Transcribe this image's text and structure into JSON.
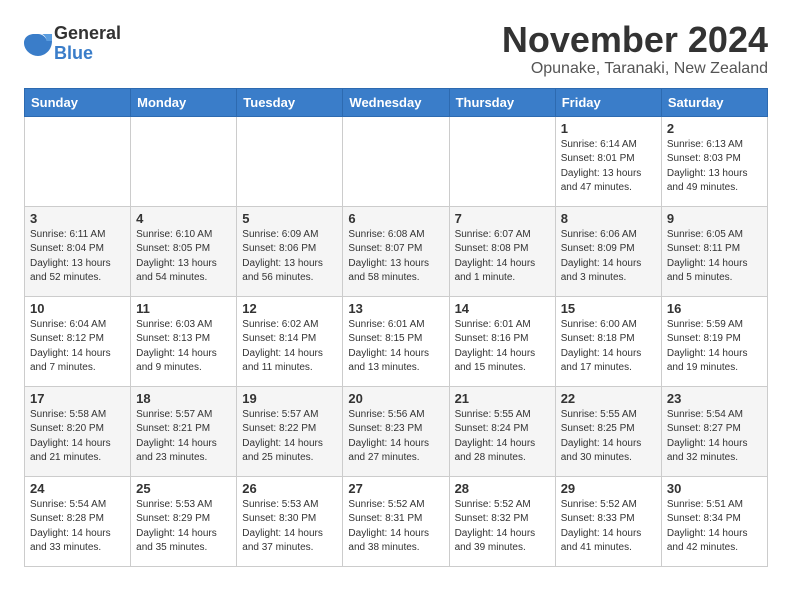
{
  "logo": {
    "general": "General",
    "blue": "Blue"
  },
  "title": "November 2024",
  "location": "Opunake, Taranaki, New Zealand",
  "weekdays": [
    "Sunday",
    "Monday",
    "Tuesday",
    "Wednesday",
    "Thursday",
    "Friday",
    "Saturday"
  ],
  "weeks": [
    [
      {
        "day": "",
        "info": ""
      },
      {
        "day": "",
        "info": ""
      },
      {
        "day": "",
        "info": ""
      },
      {
        "day": "",
        "info": ""
      },
      {
        "day": "",
        "info": ""
      },
      {
        "day": "1",
        "info": "Sunrise: 6:14 AM\nSunset: 8:01 PM\nDaylight: 13 hours\nand 47 minutes."
      },
      {
        "day": "2",
        "info": "Sunrise: 6:13 AM\nSunset: 8:03 PM\nDaylight: 13 hours\nand 49 minutes."
      }
    ],
    [
      {
        "day": "3",
        "info": "Sunrise: 6:11 AM\nSunset: 8:04 PM\nDaylight: 13 hours\nand 52 minutes."
      },
      {
        "day": "4",
        "info": "Sunrise: 6:10 AM\nSunset: 8:05 PM\nDaylight: 13 hours\nand 54 minutes."
      },
      {
        "day": "5",
        "info": "Sunrise: 6:09 AM\nSunset: 8:06 PM\nDaylight: 13 hours\nand 56 minutes."
      },
      {
        "day": "6",
        "info": "Sunrise: 6:08 AM\nSunset: 8:07 PM\nDaylight: 13 hours\nand 58 minutes."
      },
      {
        "day": "7",
        "info": "Sunrise: 6:07 AM\nSunset: 8:08 PM\nDaylight: 14 hours\nand 1 minute."
      },
      {
        "day": "8",
        "info": "Sunrise: 6:06 AM\nSunset: 8:09 PM\nDaylight: 14 hours\nand 3 minutes."
      },
      {
        "day": "9",
        "info": "Sunrise: 6:05 AM\nSunset: 8:11 PM\nDaylight: 14 hours\nand 5 minutes."
      }
    ],
    [
      {
        "day": "10",
        "info": "Sunrise: 6:04 AM\nSunset: 8:12 PM\nDaylight: 14 hours\nand 7 minutes."
      },
      {
        "day": "11",
        "info": "Sunrise: 6:03 AM\nSunset: 8:13 PM\nDaylight: 14 hours\nand 9 minutes."
      },
      {
        "day": "12",
        "info": "Sunrise: 6:02 AM\nSunset: 8:14 PM\nDaylight: 14 hours\nand 11 minutes."
      },
      {
        "day": "13",
        "info": "Sunrise: 6:01 AM\nSunset: 8:15 PM\nDaylight: 14 hours\nand 13 minutes."
      },
      {
        "day": "14",
        "info": "Sunrise: 6:01 AM\nSunset: 8:16 PM\nDaylight: 14 hours\nand 15 minutes."
      },
      {
        "day": "15",
        "info": "Sunrise: 6:00 AM\nSunset: 8:18 PM\nDaylight: 14 hours\nand 17 minutes."
      },
      {
        "day": "16",
        "info": "Sunrise: 5:59 AM\nSunset: 8:19 PM\nDaylight: 14 hours\nand 19 minutes."
      }
    ],
    [
      {
        "day": "17",
        "info": "Sunrise: 5:58 AM\nSunset: 8:20 PM\nDaylight: 14 hours\nand 21 minutes."
      },
      {
        "day": "18",
        "info": "Sunrise: 5:57 AM\nSunset: 8:21 PM\nDaylight: 14 hours\nand 23 minutes."
      },
      {
        "day": "19",
        "info": "Sunrise: 5:57 AM\nSunset: 8:22 PM\nDaylight: 14 hours\nand 25 minutes."
      },
      {
        "day": "20",
        "info": "Sunrise: 5:56 AM\nSunset: 8:23 PM\nDaylight: 14 hours\nand 27 minutes."
      },
      {
        "day": "21",
        "info": "Sunrise: 5:55 AM\nSunset: 8:24 PM\nDaylight: 14 hours\nand 28 minutes."
      },
      {
        "day": "22",
        "info": "Sunrise: 5:55 AM\nSunset: 8:25 PM\nDaylight: 14 hours\nand 30 minutes."
      },
      {
        "day": "23",
        "info": "Sunrise: 5:54 AM\nSunset: 8:27 PM\nDaylight: 14 hours\nand 32 minutes."
      }
    ],
    [
      {
        "day": "24",
        "info": "Sunrise: 5:54 AM\nSunset: 8:28 PM\nDaylight: 14 hours\nand 33 minutes."
      },
      {
        "day": "25",
        "info": "Sunrise: 5:53 AM\nSunset: 8:29 PM\nDaylight: 14 hours\nand 35 minutes."
      },
      {
        "day": "26",
        "info": "Sunrise: 5:53 AM\nSunset: 8:30 PM\nDaylight: 14 hours\nand 37 minutes."
      },
      {
        "day": "27",
        "info": "Sunrise: 5:52 AM\nSunset: 8:31 PM\nDaylight: 14 hours\nand 38 minutes."
      },
      {
        "day": "28",
        "info": "Sunrise: 5:52 AM\nSunset: 8:32 PM\nDaylight: 14 hours\nand 39 minutes."
      },
      {
        "day": "29",
        "info": "Sunrise: 5:52 AM\nSunset: 8:33 PM\nDaylight: 14 hours\nand 41 minutes."
      },
      {
        "day": "30",
        "info": "Sunrise: 5:51 AM\nSunset: 8:34 PM\nDaylight: 14 hours\nand 42 minutes."
      }
    ]
  ]
}
